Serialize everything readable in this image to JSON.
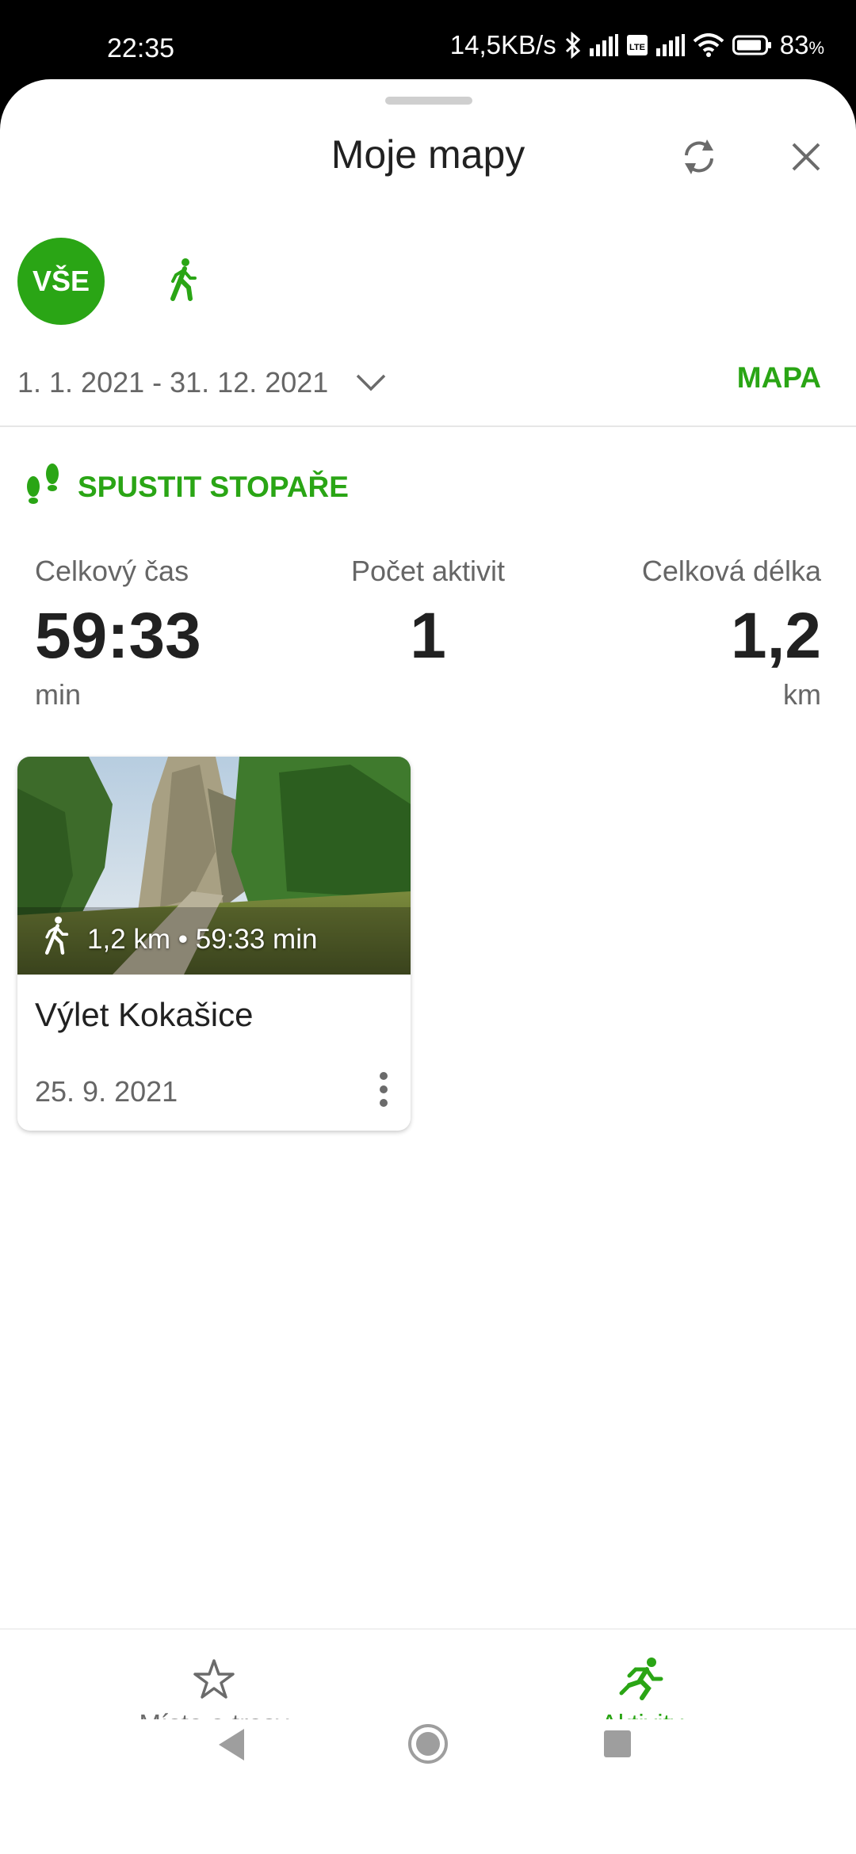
{
  "status_bar": {
    "time": "22:35",
    "network_speed": "14,5KB/s",
    "battery": "83",
    "battery_unit": "%",
    "volte_label": "Vo LTE"
  },
  "header": {
    "title": "Moje mapy",
    "sync_icon": "sync-icon",
    "close_icon": "close-icon"
  },
  "filters": {
    "all_label": "VŠE",
    "walk_icon": "walking-icon"
  },
  "date_range": {
    "value": "1. 1. 2021 - 31. 12. 2021",
    "map_label": "MAPA"
  },
  "tracker": {
    "label": "SPUSTIT STOPAŘE",
    "icon": "footprints-icon"
  },
  "stats": {
    "total_time": {
      "label": "Celkový čas",
      "value": "59:33",
      "unit": "min"
    },
    "activity_count": {
      "label": "Počet aktivit",
      "value": "1"
    },
    "total_length": {
      "label": "Celková délka",
      "value": "1,2",
      "unit": "km"
    }
  },
  "activities": [
    {
      "meta": "1,2 km • 59:33 min",
      "title": "Výlet Kokašice",
      "date": "25. 9. 2021"
    }
  ],
  "bottom_nav": {
    "places_label": "Místa a trasy",
    "activities_label": "Aktivity"
  },
  "colors": {
    "accent": "#2aa515",
    "text_primary": "#212121",
    "text_secondary": "#666666"
  }
}
